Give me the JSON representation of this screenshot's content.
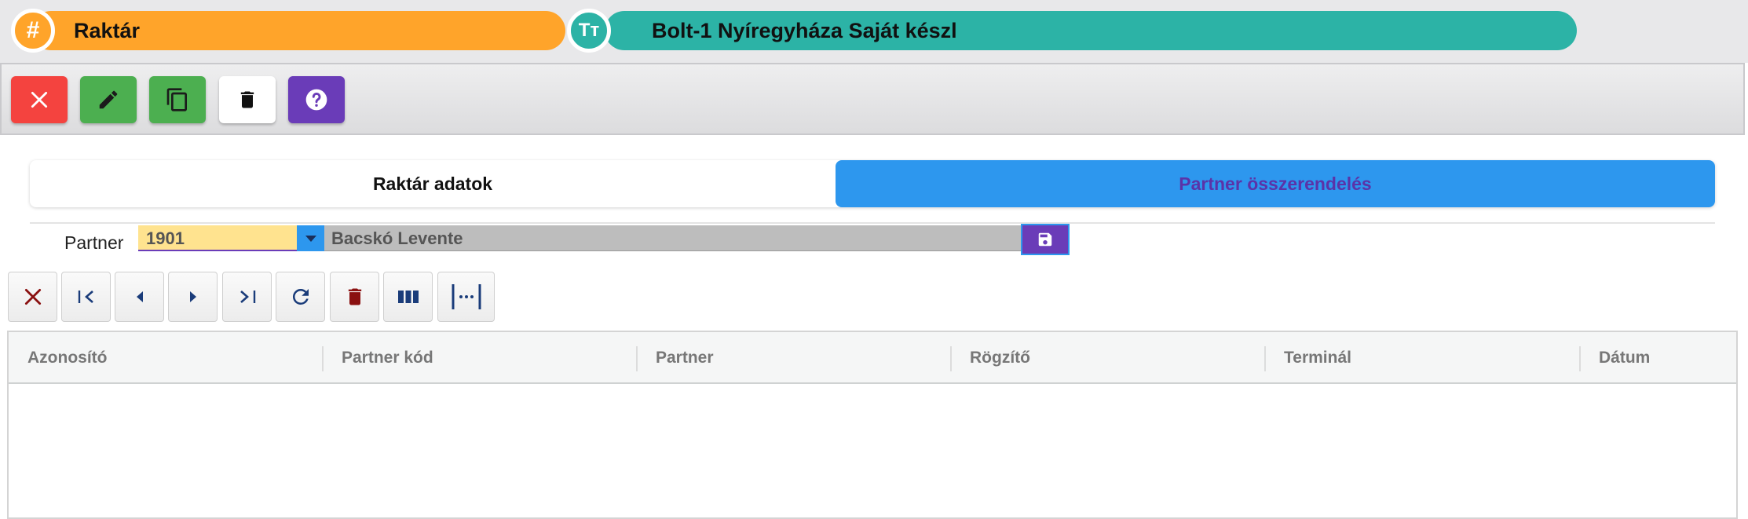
{
  "header": {
    "record_type_icon": "hash-icon",
    "record_type_glyph": "#",
    "record_type": "Raktár",
    "name_icon": "text-type-icon",
    "name_glyph": "Tт",
    "name_value": "Bolt-1 Nyíregyháza Saját készl"
  },
  "toolbar": {
    "buttons": [
      {
        "name": "close",
        "icon": "close-icon",
        "color": "#f4433f"
      },
      {
        "name": "edit",
        "icon": "pencil-icon",
        "color": "#4caf50"
      },
      {
        "name": "copy",
        "icon": "copy-icon",
        "color": "#4caf50"
      },
      {
        "name": "delete",
        "icon": "trash-icon",
        "color": "#ffffff"
      },
      {
        "name": "help",
        "icon": "help-icon",
        "color": "#6a3cb8"
      }
    ]
  },
  "tabs": {
    "items": [
      "Raktár adatok",
      "Partner összerendelés"
    ],
    "active": "Partner összerendelés"
  },
  "partner": {
    "label": "Partner",
    "code": "1901",
    "name": "Bacskó Levente"
  },
  "grid_toolbar": {
    "icons": [
      "cancel-icon",
      "first-page-icon",
      "previous-icon",
      "next-icon",
      "last-page-icon",
      "refresh-icon",
      "trash-icon",
      "columns-icon",
      "column-width-icon"
    ]
  },
  "grid": {
    "columns": [
      "Azonosító",
      "Partner kód",
      "Partner",
      "Rögzítő",
      "Terminál",
      "Dátum"
    ],
    "rows": []
  },
  "colors": {
    "orange": "#ffa42a",
    "teal": "#2cb3a6",
    "blue": "#2d97ee",
    "purple": "#6a3cb8",
    "red": "#f4433f",
    "green": "#4caf50"
  }
}
